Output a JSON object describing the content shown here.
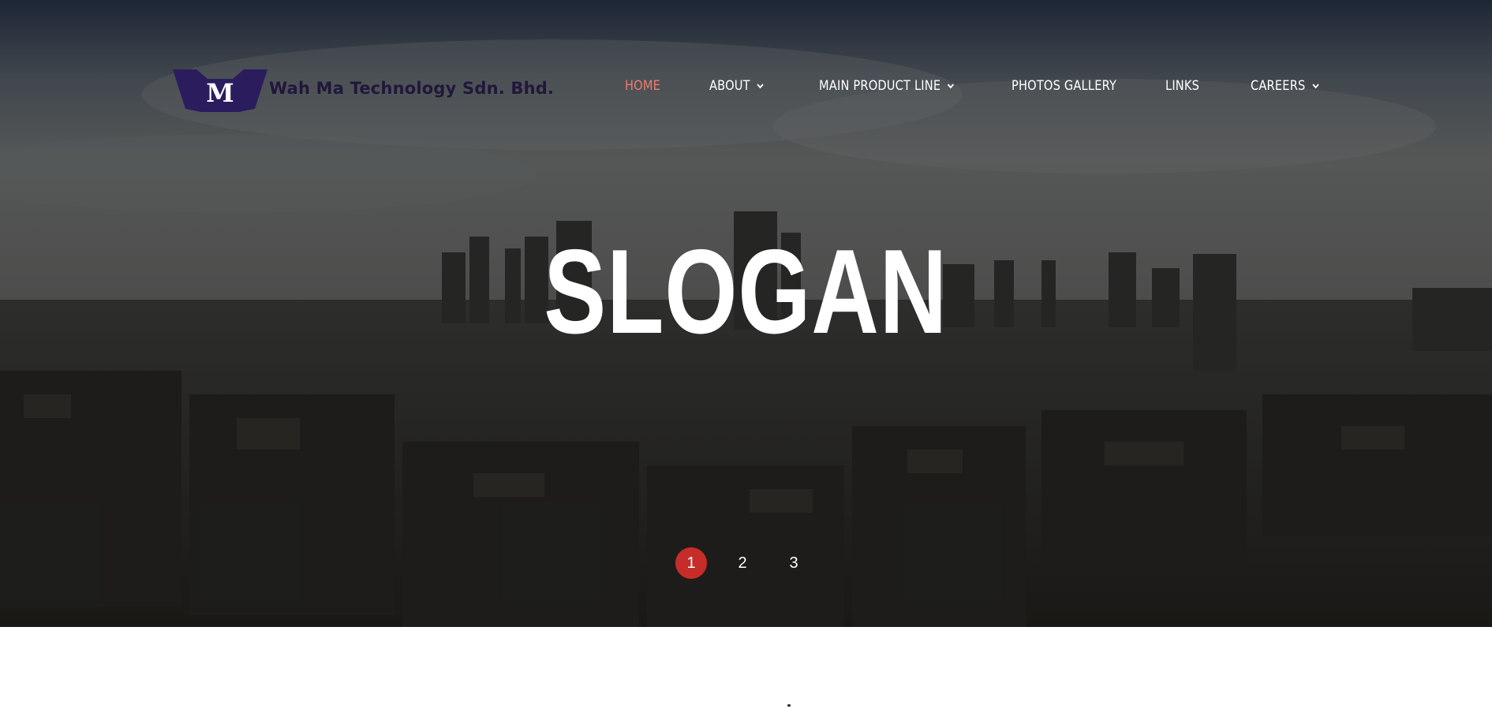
{
  "brand": {
    "logo_letter": "M",
    "name": "Wah Ma Technology Sdn. Bhd.",
    "logo_color": "#2b1c5e"
  },
  "nav": {
    "items": [
      {
        "label": "HOME",
        "active": true,
        "has_dropdown": false
      },
      {
        "label": "ABOUT",
        "active": false,
        "has_dropdown": true
      },
      {
        "label": "MAIN PRODUCT LINE",
        "active": false,
        "has_dropdown": true
      },
      {
        "label": "PHOTOS GALLERY",
        "active": false,
        "has_dropdown": false
      },
      {
        "label": "LINKS",
        "active": false,
        "has_dropdown": false
      },
      {
        "label": "CAREERS",
        "active": false,
        "has_dropdown": true
      }
    ],
    "active_color": "#f07c6d",
    "dropdown_icon": "chevron-down-icon"
  },
  "hero": {
    "slogan": "SLOGAN",
    "background": "aerial city skyline photo"
  },
  "slider": {
    "pages": [
      "1",
      "2",
      "3"
    ],
    "current": "1",
    "active_color": "#c62d28"
  }
}
